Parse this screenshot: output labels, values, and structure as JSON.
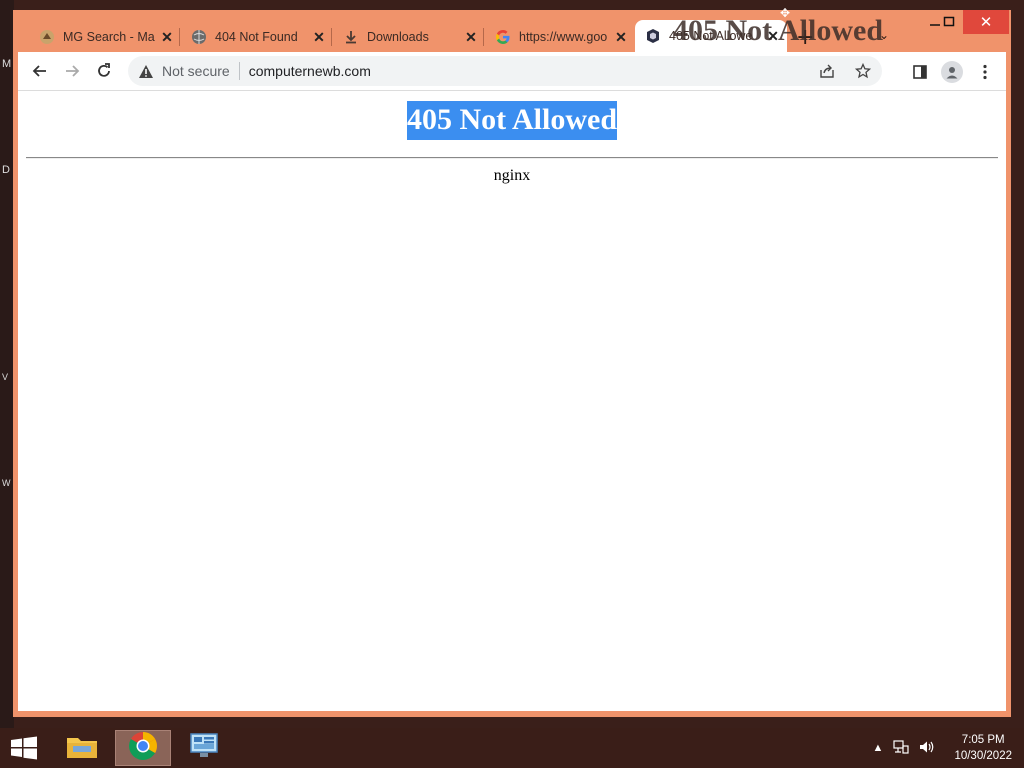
{
  "desktop": {
    "edge_letters": [
      "M",
      "D",
      "V",
      "W"
    ]
  },
  "tabs": [
    {
      "title": "MG Search - Ma",
      "icon": "mg-search-favicon"
    },
    {
      "title": "404 Not Found",
      "icon": "globe-icon"
    },
    {
      "title": "Downloads",
      "icon": "download-icon"
    },
    {
      "title": "https://www.goo",
      "icon": "google-icon"
    },
    {
      "title": "405 Not Allowe",
      "icon": "page-favicon"
    }
  ],
  "window_overlay_title": "405 Not Allowed",
  "toolbar": {
    "security_label": "Not secure",
    "url": "computernewb.com"
  },
  "page": {
    "heading": "405 Not Allowed",
    "server": "nginx"
  },
  "taskbar": {
    "time": "7:05 PM",
    "date": "10/30/2022"
  },
  "colors": {
    "frame": "#f0936b",
    "selection": "#3b8ef0",
    "taskbar": "#3a1e18"
  }
}
